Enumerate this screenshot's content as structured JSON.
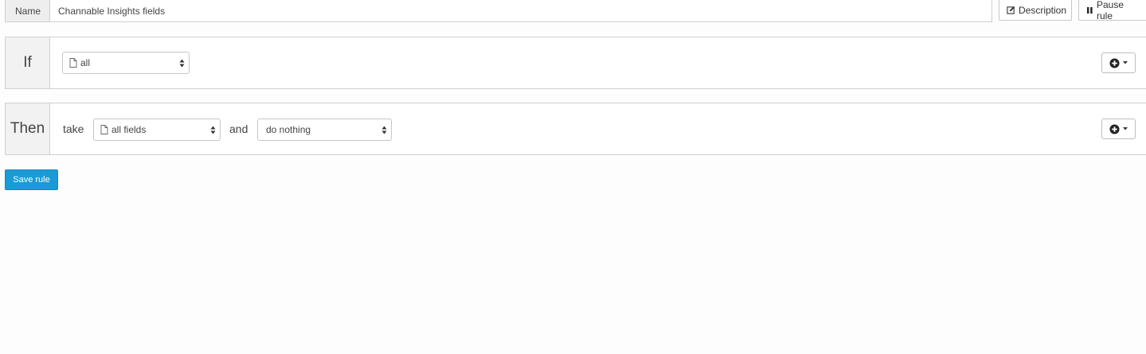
{
  "name_row": {
    "label": "Name",
    "value": "Channable Insights fields",
    "description_button": "Description",
    "pause_button": "Pause rule"
  },
  "if_panel": {
    "label": "If",
    "condition_select": "all"
  },
  "then_panel": {
    "label": "Then",
    "take_text": "take",
    "fields_select": "all fields",
    "and_text": "and",
    "action_select": "do nothing"
  },
  "save_button": "Save rule",
  "colors": {
    "accent": "#1a9ad6",
    "label_bg": "#f2f2f2",
    "border": "#d0d0d0"
  }
}
